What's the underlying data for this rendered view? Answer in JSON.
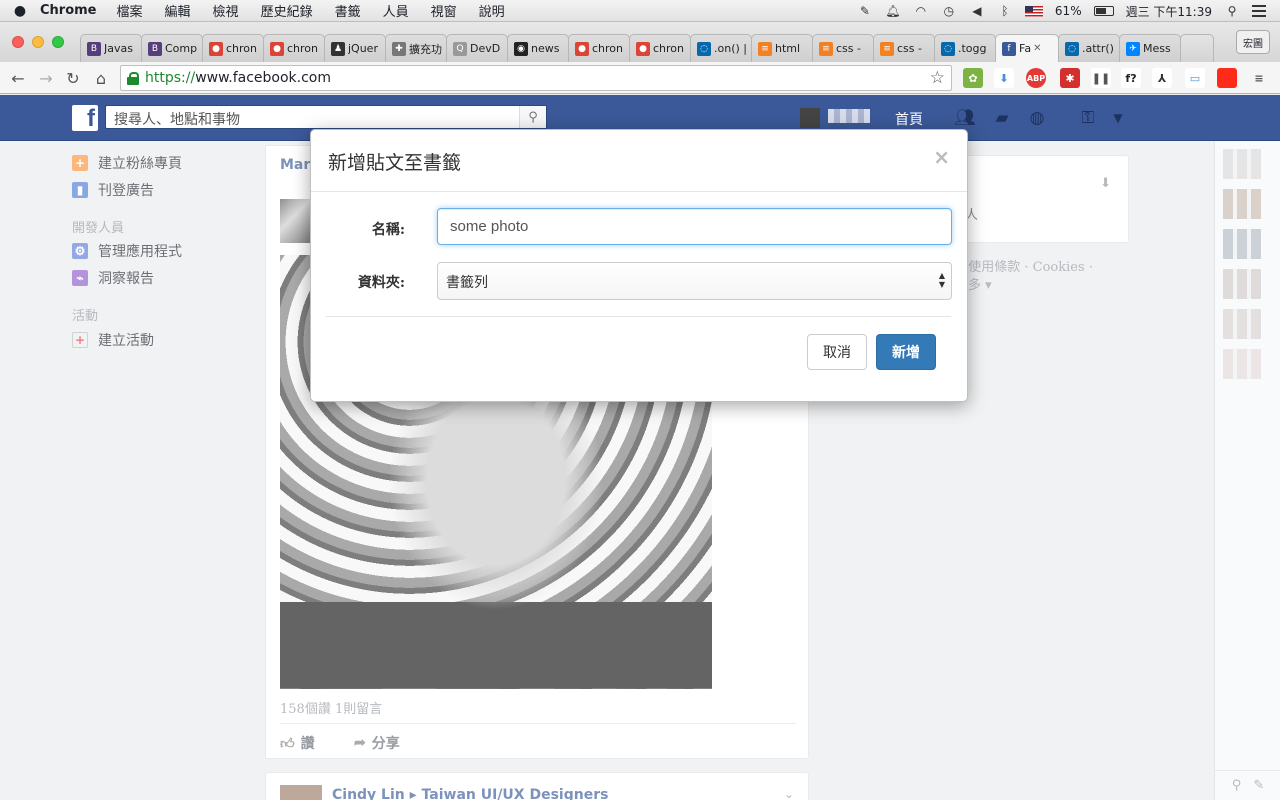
{
  "menubar": {
    "app": "Chrome",
    "items": [
      "檔案",
      "編輯",
      "檢視",
      "歷史紀錄",
      "書籤",
      "人員",
      "視窗",
      "說明"
    ],
    "battery": "61%",
    "clock": "週三 下午11:39"
  },
  "tabs": [
    {
      "label": "Javas",
      "icon": "bootstrap-icon",
      "color": "#563d7c",
      "glyph": "B"
    },
    {
      "label": "Comp",
      "icon": "bootstrap-icon",
      "color": "#563d7c",
      "glyph": "B"
    },
    {
      "label": "chron",
      "icon": "chrome-icon",
      "color": "#db4437",
      "glyph": "●"
    },
    {
      "label": "chron",
      "icon": "chrome-icon",
      "color": "#db4437",
      "glyph": "●"
    },
    {
      "label": "jQuer",
      "icon": "person-icon",
      "color": "#333333",
      "glyph": "♟"
    },
    {
      "label": "擴充功",
      "icon": "puzzle-icon",
      "color": "#777777",
      "glyph": "✚"
    },
    {
      "label": "DevD",
      "icon": "devdocs-icon",
      "color": "#999999",
      "glyph": "Q"
    },
    {
      "label": "news",
      "icon": "github-icon",
      "color": "#222222",
      "glyph": "◉"
    },
    {
      "label": "chron",
      "icon": "chrome-icon",
      "color": "#db4437",
      "glyph": "●"
    },
    {
      "label": "chron",
      "icon": "chrome-icon",
      "color": "#db4437",
      "glyph": "●"
    },
    {
      "label": ".on() |",
      "icon": "jquery-icon",
      "color": "#0769ad",
      "glyph": "◌"
    },
    {
      "label": "html",
      "icon": "stackoverflow-icon",
      "color": "#f48024",
      "glyph": "≡"
    },
    {
      "label": "css -",
      "icon": "stackoverflow-icon",
      "color": "#f48024",
      "glyph": "≡"
    },
    {
      "label": "css -",
      "icon": "stackoverflow-icon",
      "color": "#f48024",
      "glyph": "≡"
    },
    {
      "label": ".togg",
      "icon": "jquery-icon",
      "color": "#0769ad",
      "glyph": "◌"
    },
    {
      "label": "Fa",
      "icon": "facebook-icon",
      "color": "#3b5998",
      "glyph": "f",
      "active": true
    },
    {
      "label": ".attr()",
      "icon": "jquery-icon",
      "color": "#0769ad",
      "glyph": "◌"
    },
    {
      "label": "Mess",
      "icon": "messenger-icon",
      "color": "#0084ff",
      "glyph": "✈"
    }
  ],
  "profile_button": "宏圖",
  "omnibox": {
    "scheme": "https://",
    "host": "www.facebook.com"
  },
  "extensions": [
    {
      "name": "extension-color-icon",
      "glyph": "✿",
      "color": "#7cb342",
      "fg": "#ffffff"
    },
    {
      "name": "extension-download-icon",
      "glyph": "⬇",
      "color": "#ffffff",
      "fg": "#4a90d9"
    },
    {
      "name": "adblock-icon",
      "glyph": "ABP",
      "color": "#e53935",
      "fg": "#ffffff"
    },
    {
      "name": "extension-red-star-icon",
      "glyph": "✱",
      "color": "#d32f2f",
      "fg": "#ffffff"
    },
    {
      "name": "extension-pause-icon",
      "glyph": "❚❚",
      "color": "#ffffff",
      "fg": "#555555"
    },
    {
      "name": "whatfont-icon",
      "glyph": "f?",
      "color": "#ffffff",
      "fg": "#222222"
    },
    {
      "name": "extension-lambda-icon",
      "glyph": "⅄",
      "color": "#ffffff",
      "fg": "#333333"
    },
    {
      "name": "extension-window-icon",
      "glyph": "▭",
      "color": "#ffffff",
      "fg": "#4a90d9"
    },
    {
      "name": "extension-red-square-icon",
      "glyph": "",
      "color": "#ff2a1a",
      "fg": "#ffffff"
    },
    {
      "name": "chrome-menu-icon",
      "glyph": "≡",
      "color": "#f5f5f5",
      "fg": "#555555"
    }
  ],
  "fb": {
    "search_placeholder": "搜尋人、地點和事物",
    "home": "首頁",
    "left_nav": [
      {
        "type": "item",
        "label": "建立粉絲專頁",
        "icon": "create-page-icon",
        "color": "#f7923b",
        "glyph": "+"
      },
      {
        "type": "item",
        "label": "刊登廣告",
        "icon": "ads-icon",
        "color": "#4a79d4",
        "glyph": "▮"
      },
      {
        "type": "head",
        "label": "開發人員"
      },
      {
        "type": "item",
        "label": "管理應用程式",
        "icon": "app-icon",
        "color": "#5b7bd5",
        "glyph": "⚙"
      },
      {
        "type": "item",
        "label": "洞察報告",
        "icon": "insights-icon",
        "color": "#8a5bc9",
        "glyph": "⌁"
      },
      {
        "type": "head",
        "label": "活動"
      },
      {
        "type": "item",
        "label": "建立活動",
        "icon": "event-icon",
        "color": "#e9ebee",
        "glyph": "+"
      }
    ],
    "post": {
      "author": "Mark",
      "counts": "158個讚   1則留言",
      "like": "讚",
      "share": "分享"
    },
    "post2": {
      "author": "Cindy Lin ▸ Taiwan UI/UX Designers"
    },
    "right": {
      "fragment": "人",
      "footer": "· 使用條款 · Cookies ·",
      "more": "多 ▾"
    },
    "chat_colors": [
      "#d8d8d8",
      "#c8b8b0",
      "#b0b8c0",
      "#d0c8c8",
      "#d8d0d0",
      "#e0d8d8"
    ]
  },
  "modal": {
    "title": "新增貼文至書籤",
    "close": "×",
    "name_label": "名稱:",
    "name_value": "some photo",
    "folder_label": "資料夾:",
    "folder_value": "書籤列",
    "cancel": "取消",
    "add": "新增"
  }
}
